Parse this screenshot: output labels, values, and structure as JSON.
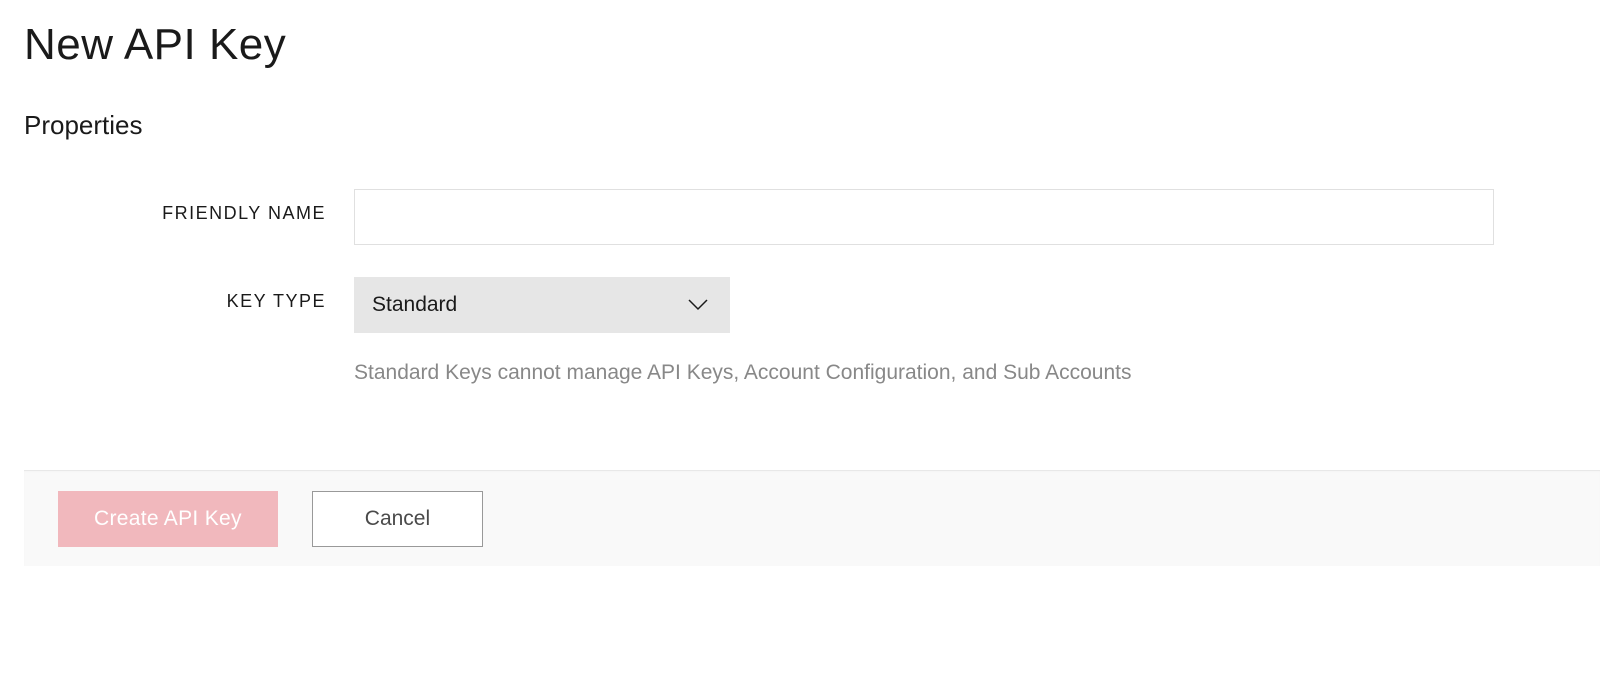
{
  "header": {
    "title": "New API Key"
  },
  "section": {
    "title": "Properties"
  },
  "form": {
    "friendlyName": {
      "label": "FRIENDLY NAME",
      "value": ""
    },
    "keyType": {
      "label": "KEY TYPE",
      "selected": "Standard",
      "helpText": "Standard Keys cannot manage API Keys, Account Configuration, and Sub Accounts"
    }
  },
  "actions": {
    "create": "Create API Key",
    "cancel": "Cancel"
  }
}
